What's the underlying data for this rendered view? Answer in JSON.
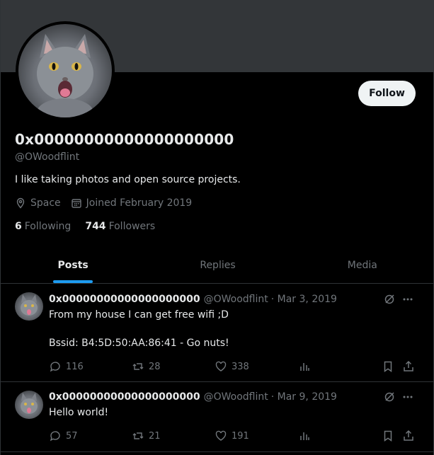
{
  "profile": {
    "display_name": "0x00000000000000000000",
    "handle": "@OWoodflint",
    "bio": "I like taking photos and open source projects.",
    "location": "Space",
    "joined": "Joined February 2019",
    "following_count": "6",
    "following_label": "Following",
    "followers_count": "744",
    "followers_label": "Followers",
    "follow_button": "Follow"
  },
  "tabs": [
    {
      "label": "Posts",
      "active": true
    },
    {
      "label": "Replies",
      "active": false
    },
    {
      "label": "Media",
      "active": false
    }
  ],
  "posts": [
    {
      "name": "0x00000000000000000000",
      "handle": "@OWoodflint",
      "date": "· Mar 3, 2019",
      "line1": "From my house I can get free wifi ;D",
      "line2": "Bssid: B4:5D:50:AA:86:41 - Go nuts!",
      "replies": "116",
      "reposts": "28",
      "likes": "338"
    },
    {
      "name": "0x00000000000000000000",
      "handle": "@OWoodflint",
      "date": "· Mar 9, 2019",
      "line1": "Hello world!",
      "replies": "57",
      "reposts": "21",
      "likes": "191"
    }
  ],
  "colors": {
    "accent": "#1d9bf0",
    "muted": "#71767b",
    "background": "#000000",
    "banner": "#333639"
  }
}
